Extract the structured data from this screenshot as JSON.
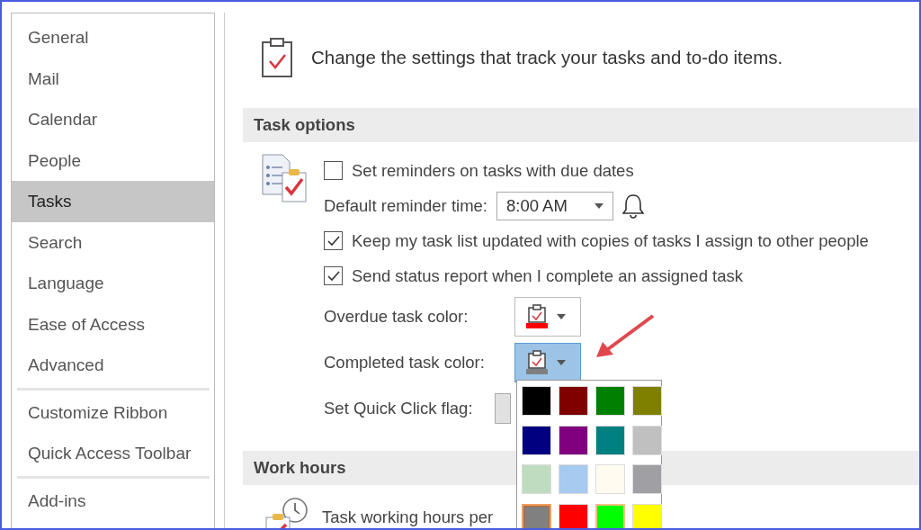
{
  "sidebar": {
    "groups": [
      [
        {
          "label": "General",
          "selected": false
        },
        {
          "label": "Mail",
          "selected": false
        },
        {
          "label": "Calendar",
          "selected": false
        },
        {
          "label": "People",
          "selected": false
        },
        {
          "label": "Tasks",
          "selected": true
        },
        {
          "label": "Search",
          "selected": false
        },
        {
          "label": "Language",
          "selected": false
        },
        {
          "label": "Ease of Access",
          "selected": false
        },
        {
          "label": "Advanced",
          "selected": false
        }
      ],
      [
        {
          "label": "Customize Ribbon",
          "selected": false
        },
        {
          "label": "Quick Access Toolbar",
          "selected": false
        }
      ],
      [
        {
          "label": "Add-ins",
          "selected": false
        }
      ]
    ]
  },
  "header": {
    "text": "Change the settings that track your tasks and to-do items."
  },
  "task_options": {
    "title": "Task options",
    "reminders": {
      "label": "Set reminders on tasks with due dates",
      "checked": false
    },
    "default_reminder": {
      "label": "Default reminder time:",
      "value": "8:00 AM"
    },
    "keep_updated": {
      "label": "Keep my task list updated with copies of tasks I assign to other people",
      "checked": true
    },
    "send_status": {
      "label": "Send status report when I complete an assigned task",
      "checked": true
    },
    "overdue_color": {
      "label": "Overdue task color:",
      "color": "#ff0000",
      "expanded": false
    },
    "completed_color": {
      "label": "Completed task color:",
      "color": "#808080",
      "expanded": true
    },
    "quick_click": {
      "label": "Set Quick Click flag:"
    }
  },
  "color_palette": {
    "swatches": [
      {
        "color": "#000000",
        "selected": false,
        "hovered": false
      },
      {
        "color": "#800000",
        "selected": false,
        "hovered": false
      },
      {
        "color": "#008000",
        "selected": false,
        "hovered": false
      },
      {
        "color": "#808000",
        "selected": false,
        "hovered": false
      },
      {
        "color": "#000080",
        "selected": false,
        "hovered": false
      },
      {
        "color": "#800080",
        "selected": false,
        "hovered": false
      },
      {
        "color": "#008080",
        "selected": false,
        "hovered": false
      },
      {
        "color": "#c0c0c0",
        "selected": false,
        "hovered": false
      },
      {
        "color": "#c0dcc0",
        "selected": false,
        "hovered": false
      },
      {
        "color": "#a6caf0",
        "selected": false,
        "hovered": false
      },
      {
        "color": "#fffbf0",
        "selected": false,
        "hovered": false
      },
      {
        "color": "#a0a0a4",
        "selected": false,
        "hovered": false
      },
      {
        "color": "#808080",
        "selected": true,
        "hovered": false
      },
      {
        "color": "#ff0000",
        "selected": false,
        "hovered": false
      },
      {
        "color": "#00ff00",
        "selected": false,
        "hovered": true
      },
      {
        "color": "#ffff00",
        "selected": false,
        "hovered": false
      }
    ]
  },
  "work_hours": {
    "title": "Work hours",
    "label": "Task working hours per"
  }
}
